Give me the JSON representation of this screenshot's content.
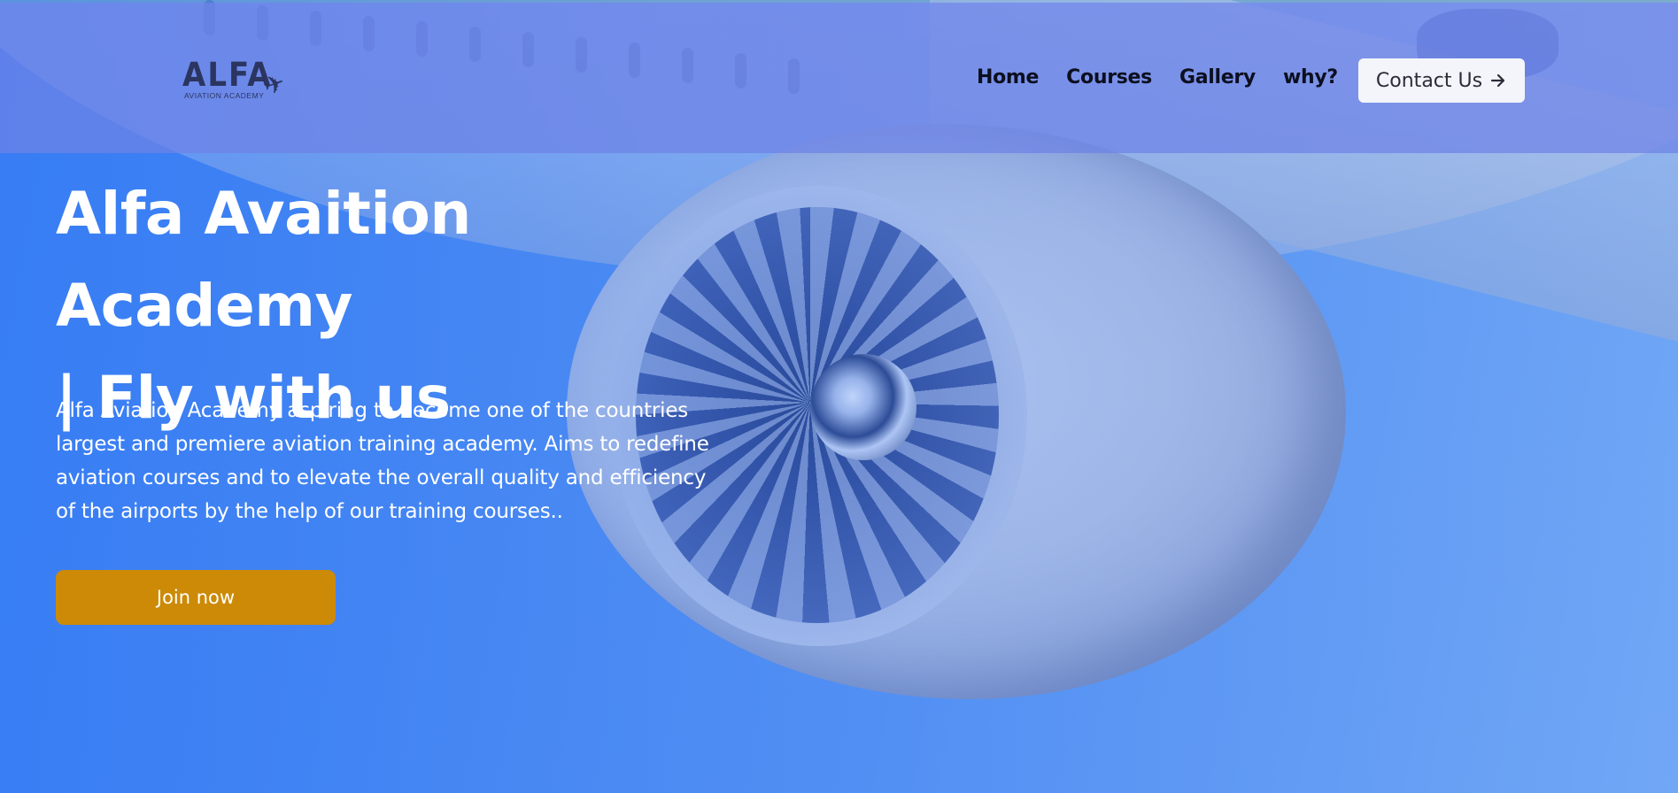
{
  "colors": {
    "header_bg": "#6e82e6",
    "hero_blue": "#3d82f2",
    "join_button": "#cc8a06",
    "contact_button_bg": "#f4f5fa"
  },
  "brand": {
    "logo_title": "ALFA",
    "logo_subtitle": "AVIATION ACADEMY",
    "logo_icon": "airplane-icon"
  },
  "nav": {
    "items": [
      {
        "label": "Home"
      },
      {
        "label": "Courses"
      },
      {
        "label": "Gallery"
      },
      {
        "label": "why?"
      }
    ],
    "contact_label": "Contact Us",
    "contact_icon": "arrow-right-icon"
  },
  "hero": {
    "title_line1": "Alfa Avaition Academy",
    "title_line2": "| Fly with us",
    "description": "Alfa Aviation Academy aspiring to become one of the countries largest and premiere aviation training academy. Aims to redefine aviation courses and to elevate the overall quality and efficiency of the airports by the help of our training courses..",
    "cta_label": "Join now"
  }
}
